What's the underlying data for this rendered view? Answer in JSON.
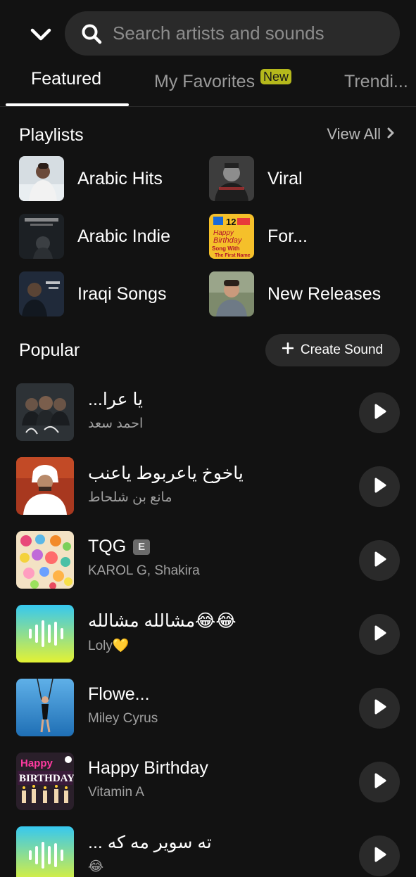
{
  "header": {
    "search_placeholder": "Search artists and sounds"
  },
  "tabs": [
    {
      "label": "Featured",
      "active": true
    },
    {
      "label": "My Favorites",
      "badge": "New"
    },
    {
      "label": "Trendi..."
    }
  ],
  "playlists": {
    "title": "Playlists",
    "view_all": "View All",
    "items": [
      {
        "label": "Arabic Hits"
      },
      {
        "label": "Viral"
      },
      {
        "label": "Arabic Indie"
      },
      {
        "label": "For..."
      },
      {
        "label": "Iraqi Songs"
      },
      {
        "label": "New Releases"
      }
    ]
  },
  "popular": {
    "title": "Popular",
    "create_label": "Create Sound",
    "items": [
      {
        "title": "يا عرا...",
        "artist": "احمد سعد"
      },
      {
        "title": "ياخوخ ياعربوط ياعنب",
        "artist": "مانع بن شلحاط"
      },
      {
        "title": "TQG",
        "explicit": "E",
        "artist": "KAROL G, Shakira"
      },
      {
        "title": "😂😂مشالله مشالله",
        "artist": "Loly💛"
      },
      {
        "title": "Flowe...",
        "artist": "Miley Cyrus"
      },
      {
        "title": "Happy Birthday",
        "artist": "Vitamin A"
      },
      {
        "title": "ته سوير مه كه ...",
        "artist": "😂"
      }
    ]
  },
  "thumb_text": {
    "birthday_num": "12",
    "birthday_line1": "Happy",
    "birthday_line2": "Birthday",
    "birthday_line3": "Song With",
    "birthday_line4": "The First Name",
    "hb_line1": "Happy",
    "hb_line2": "BIRTHDAY"
  },
  "colors": {
    "background": "#121212",
    "surface": "#2a2a2a",
    "new_badge": "#b5b81c"
  }
}
